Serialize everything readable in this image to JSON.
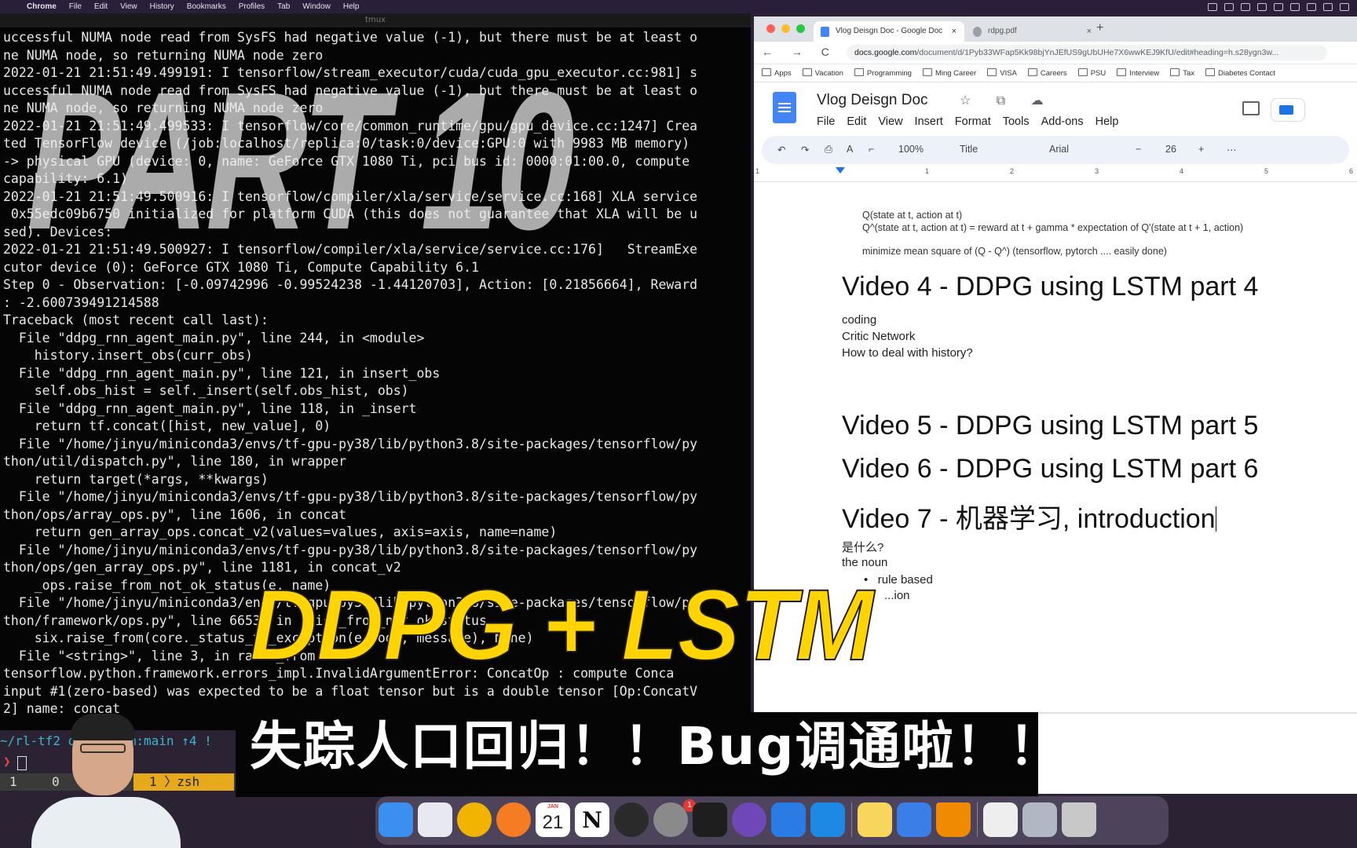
{
  "menubar": {
    "app": "Chrome",
    "items": [
      "File",
      "Edit",
      "View",
      "History",
      "Bookmarks",
      "Profiles",
      "Tab",
      "Window",
      "Help"
    ]
  },
  "terminal": {
    "title": "tmux",
    "lines": [
      "uccessful NUMA node read from SysFS had negative value (-1), but there must be at least o",
      "ne NUMA node, so returning NUMA node zero",
      "2022-01-21 21:51:49.499191: I tensorflow/stream_executor/cuda/cuda_gpu_executor.cc:981] s",
      "uccessful NUMA node read from SysFS had negative value (-1), but there must be at least o",
      "ne NUMA node, so returning NUMA node zero",
      "2022-01-21 21:51:49.499533: I tensorflow/core/common_runtime/gpu/gpu_device.cc:1247] Crea",
      "ted TensorFlow device (/job:localhost/replica:0/task:0/device:GPU:0 with 9983 MB memory)",
      "-> physical GPU (device: 0, name: GeForce GTX 1080 Ti, pci bus id: 0000:01:00.0, compute",
      "capability: 6.1)",
      "2022-01-21 21:51:49.500916: I tensorflow/compiler/xla/service/service.cc:168] XLA service",
      " 0x55edc09b6750 initialized for platform CUDA (this does not guarantee that XLA will be u",
      "sed). Devices:",
      "2022-01-21 21:51:49.500927: I tensorflow/compiler/xla/service/service.cc:176]   StreamExe",
      "cutor device (0): GeForce GTX 1080 Ti, Compute Capability 6.1",
      "Step 0 - Observation: [-0.09742996 -0.99524238 -1.44120703], Action: [0.21856664], Reward",
      ": -2.600739491214588",
      "Traceback (most recent call last):",
      "  File \"ddpg_rnn_agent_main.py\", line 244, in <module>",
      "    history.insert_obs(curr_obs)",
      "  File \"ddpg_rnn_agent_main.py\", line 121, in insert_obs",
      "    self.obs_hist = self._insert(self.obs_hist, obs)",
      "  File \"ddpg_rnn_agent_main.py\", line 118, in _insert",
      "    return tf.concat([hist, new_value], 0)",
      "  File \"/home/jinyu/miniconda3/envs/tf-gpu-py38/lib/python3.8/site-packages/tensorflow/py",
      "thon/util/dispatch.py\", line 180, in wrapper",
      "    return target(*args, **kwargs)",
      "  File \"/home/jinyu/miniconda3/envs/tf-gpu-py38/lib/python3.8/site-packages/tensorflow/py",
      "thon/ops/array_ops.py\", line 1606, in concat",
      "    return gen_array_ops.concat_v2(values=values, axis=axis, name=name)",
      "  File \"/home/jinyu/miniconda3/envs/tf-gpu-py38/lib/python3.8/site-packages/tensorflow/py",
      "thon/ops/gen_array_ops.py\", line 1181, in concat_v2",
      "    _ops.raise_from_not_ok_status(e, name)",
      "  File \"/home/jinyu/miniconda3/envs/tf-gpu-py38/lib/python3.8/site-packages/tensorflow/py",
      "thon/framework/ops.py\", line 6653, in raise_from_not_ok_status",
      "    six.raise_from(core._status_to_exception(e.code, message), None)",
      "  File \"<string>\", line 3, in raise_from",
      "tensorflow.python.framework.errors_impl.InvalidArgumentError: ConcatOp : compute Conca",
      "input #1(zero-based) was expected to be a float tensor but is a double tensor [Op:ConcatV",
      "2] name: concat"
    ],
    "prompt": "~/rl-tf2 ddpg-lstm:main ↑4 !",
    "caret": "❯",
    "tmux": {
      "win1": "1",
      "win2": "0",
      "active": "1 〉zsh"
    }
  },
  "browser": {
    "tabs": [
      {
        "label": "Vlog Deisgn Doc - Google Doc",
        "close": "×"
      },
      {
        "label": "rdpg.pdf",
        "close": "×"
      }
    ],
    "newtab": "+",
    "nav": "← → C ⌂",
    "url_host": "docs.google.com",
    "url_rest": "/document/d/1Pyb33WFap5Kk98bjYnJEfUS9gUbUHe7X6wwKEJ9KfU/edit#heading=h.s28ygn3w...",
    "bookmarks": [
      "Apps",
      "Vacation",
      "Programming",
      "Ming Career",
      "VISA",
      "Careers",
      "PSU",
      "Interview",
      "Tax",
      "Diabetes Contact"
    ]
  },
  "docs": {
    "title": "Vlog Deisgn Doc",
    "title_icons": "☆ ⧉ ☁",
    "menu": [
      "File",
      "Edit",
      "View",
      "Insert",
      "Format",
      "Tools",
      "Add-ons",
      "Help"
    ],
    "toolbar": {
      "zoom": "100%",
      "style": "Title",
      "font": "Arial",
      "size": "26",
      "minus": "−",
      "plus": "+",
      "more": "⋯"
    },
    "ruler": [
      "1",
      "1",
      "2",
      "3",
      "4",
      "5",
      "6"
    ],
    "content": {
      "q1": "Q(state at t, action at t)",
      "q2": "Q^(state at t, action at t) = reward at t + gamma * expectation of Q'(state at t + 1, action)",
      "q3": "minimize mean square of (Q - Q^) (tensorflow, pytorch .... easily done)",
      "h4": "Video 4 - DDPG using LSTM part 4",
      "b1": "coding",
      "b2": "Critic Network",
      "b3": "How to deal with history?",
      "h5": "Video 5 - DDPG using LSTM part 5",
      "h6": "Video 6 - DDPG using LSTM part 6",
      "h7": "Video 7 - 机器学习, introduction",
      "c1": "是什么?",
      "c2": "the noun",
      "bullet1": "rule based",
      "bullet2": "...ion"
    }
  },
  "overlay": {
    "part": "PART 10",
    "headline": "DDPG + LSTM",
    "subtitle": "失踪人口回归！！Bug调通啦！！"
  },
  "dock": {
    "calendar_month": "JAN",
    "calendar_day": "21",
    "notion": "N",
    "badge": "1",
    "colors": {
      "finder": "#3b8ff0",
      "launchpad": "#e8e8f0",
      "chrome": "#f2b400",
      "firefox": "#f57c22",
      "calendar": "#ffffff",
      "notion": "#ffffff",
      "obs": "#2a2a2a",
      "settings": "#8a8a8a",
      "terminal": "#1e1e1e",
      "emacs": "#6f48b8",
      "mail": "#2a7be4",
      "vscode": "#1e88e5",
      "notes": "#f8d65c",
      "keynote": "#3c7ee8",
      "vlc": "#f08a00",
      "docs": "#eeeeee",
      "preview": "#b0b8c4",
      "trash": "#c8c8c8"
    }
  }
}
